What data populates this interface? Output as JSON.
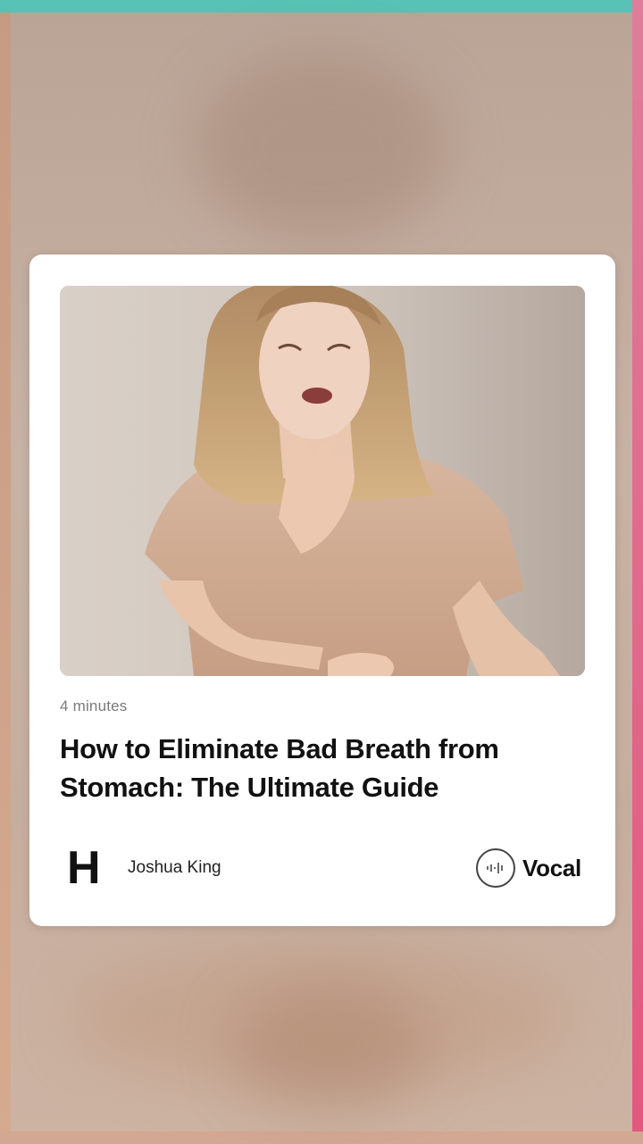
{
  "card": {
    "read_time": "4 minutes",
    "title": "How to Eliminate Bad Breath from Stomach: The Ultimate Guide",
    "author_initial": "H",
    "author_name": "Joshua King",
    "brand_name": "Vocal",
    "brand_icon": "sound-wave-icon"
  },
  "colors": {
    "top_accent": "#57c2b5",
    "right_accent": "#e2587e",
    "background": "#c4ad9f"
  }
}
